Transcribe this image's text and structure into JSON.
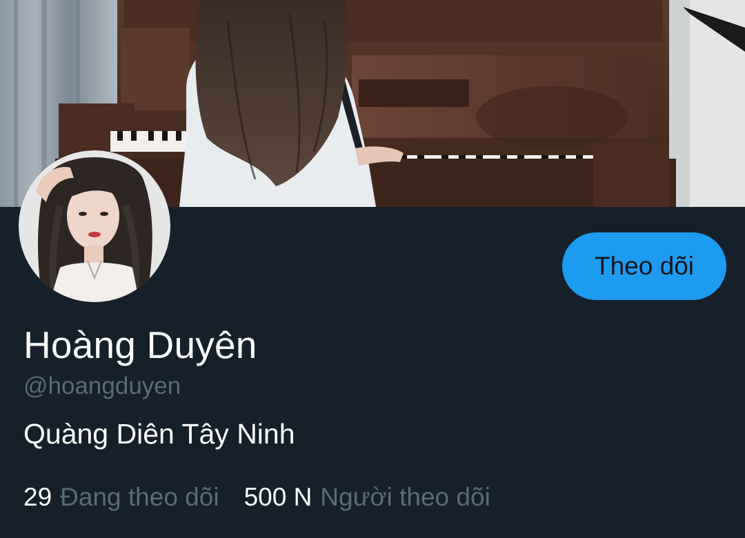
{
  "profile": {
    "display_name": "Hoàng Duyên",
    "handle": "@hoangduyen",
    "bio": "Quàng Diên Tây Ninh"
  },
  "actions": {
    "follow_label": "Theo dõi"
  },
  "stats": {
    "following_count": "29",
    "following_label": "Đang theo dõi",
    "followers_count": "500 N",
    "followers_label": "Người theo dõi"
  },
  "colors": {
    "background": "#15202b",
    "accent": "#1d9bf0",
    "primary_text": "#ffffff",
    "secondary_text": "#5c6b78"
  },
  "images": {
    "banner": "banner-photo-piano",
    "avatar": "avatar-photo"
  }
}
